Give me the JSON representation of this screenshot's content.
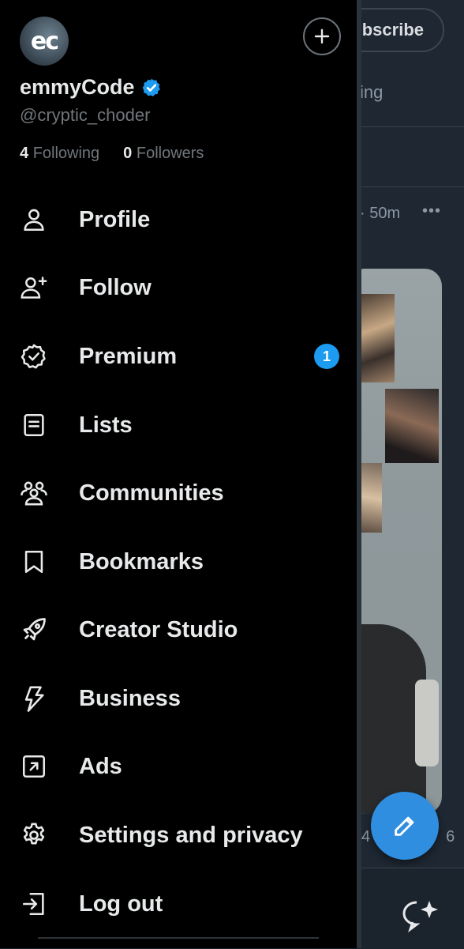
{
  "background": {
    "subscribe_label": "bscribe",
    "tab_fragment": "ing",
    "post_time": "· 50m",
    "more": "•••",
    "stats_fragment": "4",
    "stats_end": "6"
  },
  "profile": {
    "avatar_initials": "ec",
    "display_name": "emmyCode",
    "handle": "@cryptic_choder",
    "following_count": "4",
    "following_label": "Following",
    "followers_count": "0",
    "followers_label": "Followers"
  },
  "menu": [
    {
      "label": "Profile",
      "icon": "person-icon"
    },
    {
      "label": "Follow",
      "icon": "person-add-icon"
    },
    {
      "label": "Premium",
      "icon": "verified-badge-icon",
      "badge": "1"
    },
    {
      "label": "Lists",
      "icon": "list-icon"
    },
    {
      "label": "Communities",
      "icon": "communities-icon"
    },
    {
      "label": "Bookmarks",
      "icon": "bookmark-icon"
    },
    {
      "label": "Creator Studio",
      "icon": "rocket-icon"
    },
    {
      "label": "Business",
      "icon": "lightning-icon"
    },
    {
      "label": "Ads",
      "icon": "ads-arrow-icon"
    },
    {
      "label": "Settings and privacy",
      "icon": "gear-icon"
    },
    {
      "label": "Log out",
      "icon": "logout-icon"
    }
  ],
  "colors": {
    "accent": "#1d9bf0",
    "drawer_bg": "#000000",
    "timeline_bg": "#1e2732",
    "fab": "#2f8ee0"
  }
}
